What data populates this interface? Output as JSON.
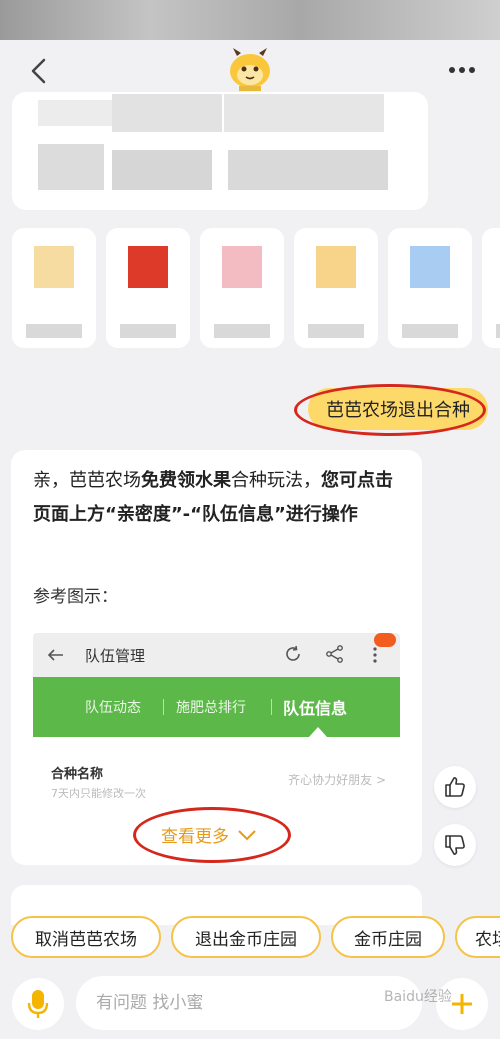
{
  "header": {
    "back_icon": "chevron-left-icon",
    "mascot_icon": "bee-mascot-icon",
    "more_icon": "more-dots-icon"
  },
  "user_message": "芭芭农场退出合种",
  "bot_reply": {
    "p1": "亲，芭芭农场",
    "p2_bold": "免费领水果",
    "p3": "合种玩法，",
    "p4_bold": "您可点击页面上方“亲密度”-“队伍信息”进行操作",
    "ref_label": "参考图示：",
    "preview": {
      "title": "队伍管理",
      "tabs": [
        "队伍动态",
        "施肥总排行",
        "队伍信息"
      ],
      "active_tab": 2,
      "row_label": "合种名称",
      "row_hint": "7天内只能修改一次",
      "row_value": "齐心协力好朋友 >"
    },
    "see_more": "查看更多"
  },
  "feedback": {
    "like_icon": "thumbs-up-icon",
    "dislike_icon": "thumbs-down-icon"
  },
  "suggestions": [
    "取消芭芭农场",
    "退出金币庄园",
    "金币庄园",
    "农场"
  ],
  "input": {
    "placeholder": "有问题 找小蜜",
    "mic_icon": "microphone-icon",
    "plus_icon": "plus-icon"
  },
  "colors": {
    "accent": "#fdd96a",
    "chip_border": "#f5c34a",
    "highlight_ring": "#d6271c",
    "preview_green": "#5cb849",
    "see_more": "#e69a18"
  },
  "watermark": "Baidu经验"
}
